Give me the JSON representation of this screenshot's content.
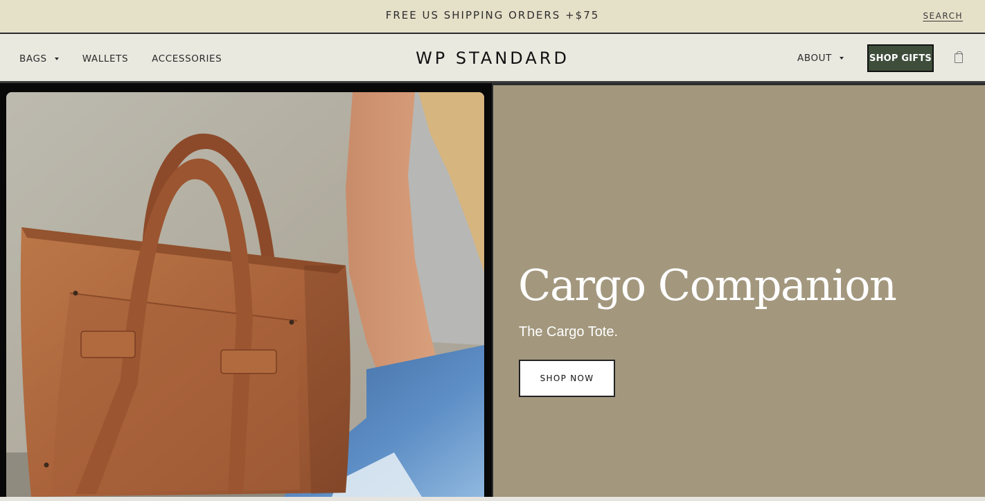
{
  "announcement": {
    "text": "FREE US SHIPPING ORDERS +$75",
    "search_label": "SEARCH"
  },
  "nav": {
    "left_items": [
      {
        "label": "BAGS",
        "has_dropdown": true
      },
      {
        "label": "WALLETS",
        "has_dropdown": false
      },
      {
        "label": "ACCESSORIES",
        "has_dropdown": false
      }
    ],
    "logo": "WP STANDARD",
    "about_label": "ABOUT",
    "shop_gifts_label": "SHOP GIFTS",
    "cart_icon": "shopping-bag-icon"
  },
  "hero": {
    "headline": "Cargo Companion",
    "subheadline": "The Cargo Tote.",
    "cta_label": "SHOP NOW",
    "image": "brown leather tote bag beside person in grey tank top and jeans"
  },
  "colors": {
    "announcement_bg": "#e5e0c8",
    "nav_bg": "#eae9e0",
    "hero_panel_bg": "#a3987e",
    "gifts_button_bg": "#3e4e3b",
    "leather": "#b06a3e"
  }
}
